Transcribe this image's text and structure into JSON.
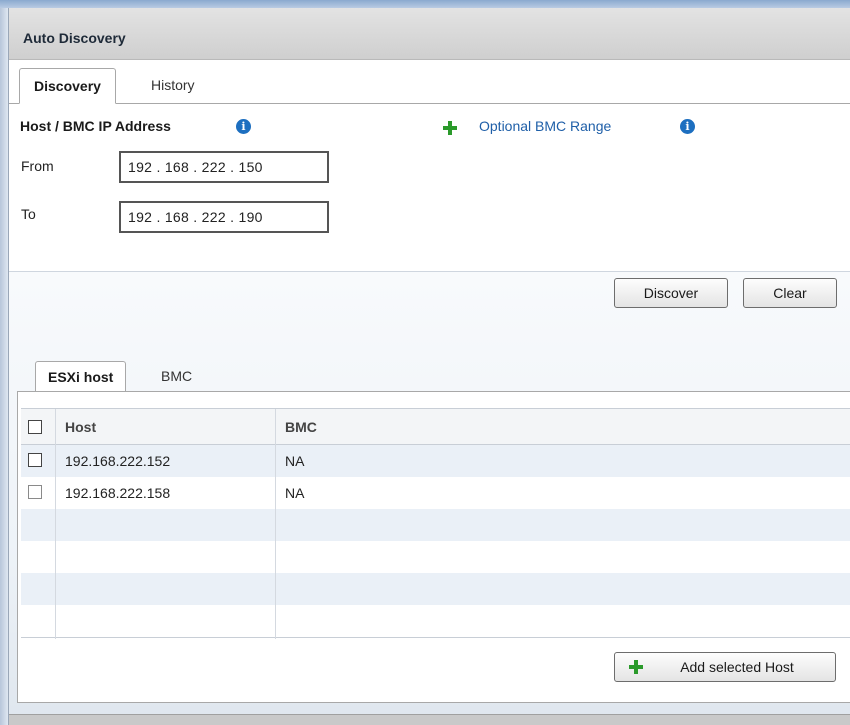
{
  "panel": {
    "title": "Auto Discovery"
  },
  "tabs": [
    {
      "label": "Discovery",
      "active": true
    },
    {
      "label": "History",
      "active": false
    }
  ],
  "discovery": {
    "section_label": "Host / BMC IP Address",
    "optional_link": "Optional BMC Range",
    "from_label": "From",
    "from_value": "192 . 168 . 222 . 150",
    "to_label": "To",
    "to_value": "192 . 168 . 222 . 190",
    "discover_button": "Discover",
    "clear_button": "Clear"
  },
  "result_tabs": [
    {
      "label": "ESXi host",
      "active": true
    },
    {
      "label": "BMC",
      "active": false
    }
  ],
  "table": {
    "columns": [
      "Host",
      "BMC"
    ],
    "rows": [
      {
        "host": "192.168.222.152",
        "bmc": "NA"
      },
      {
        "host": "192.168.222.158",
        "bmc": "NA"
      }
    ]
  },
  "add_button": "Add selected Host",
  "icons": {
    "info": "info-icon",
    "add": "plus-icon"
  },
  "colors": {
    "link": "#1f5fa8",
    "info": "#1d6fc0",
    "add": "#2b9a2b",
    "row_alt": "#eaf0f7"
  }
}
